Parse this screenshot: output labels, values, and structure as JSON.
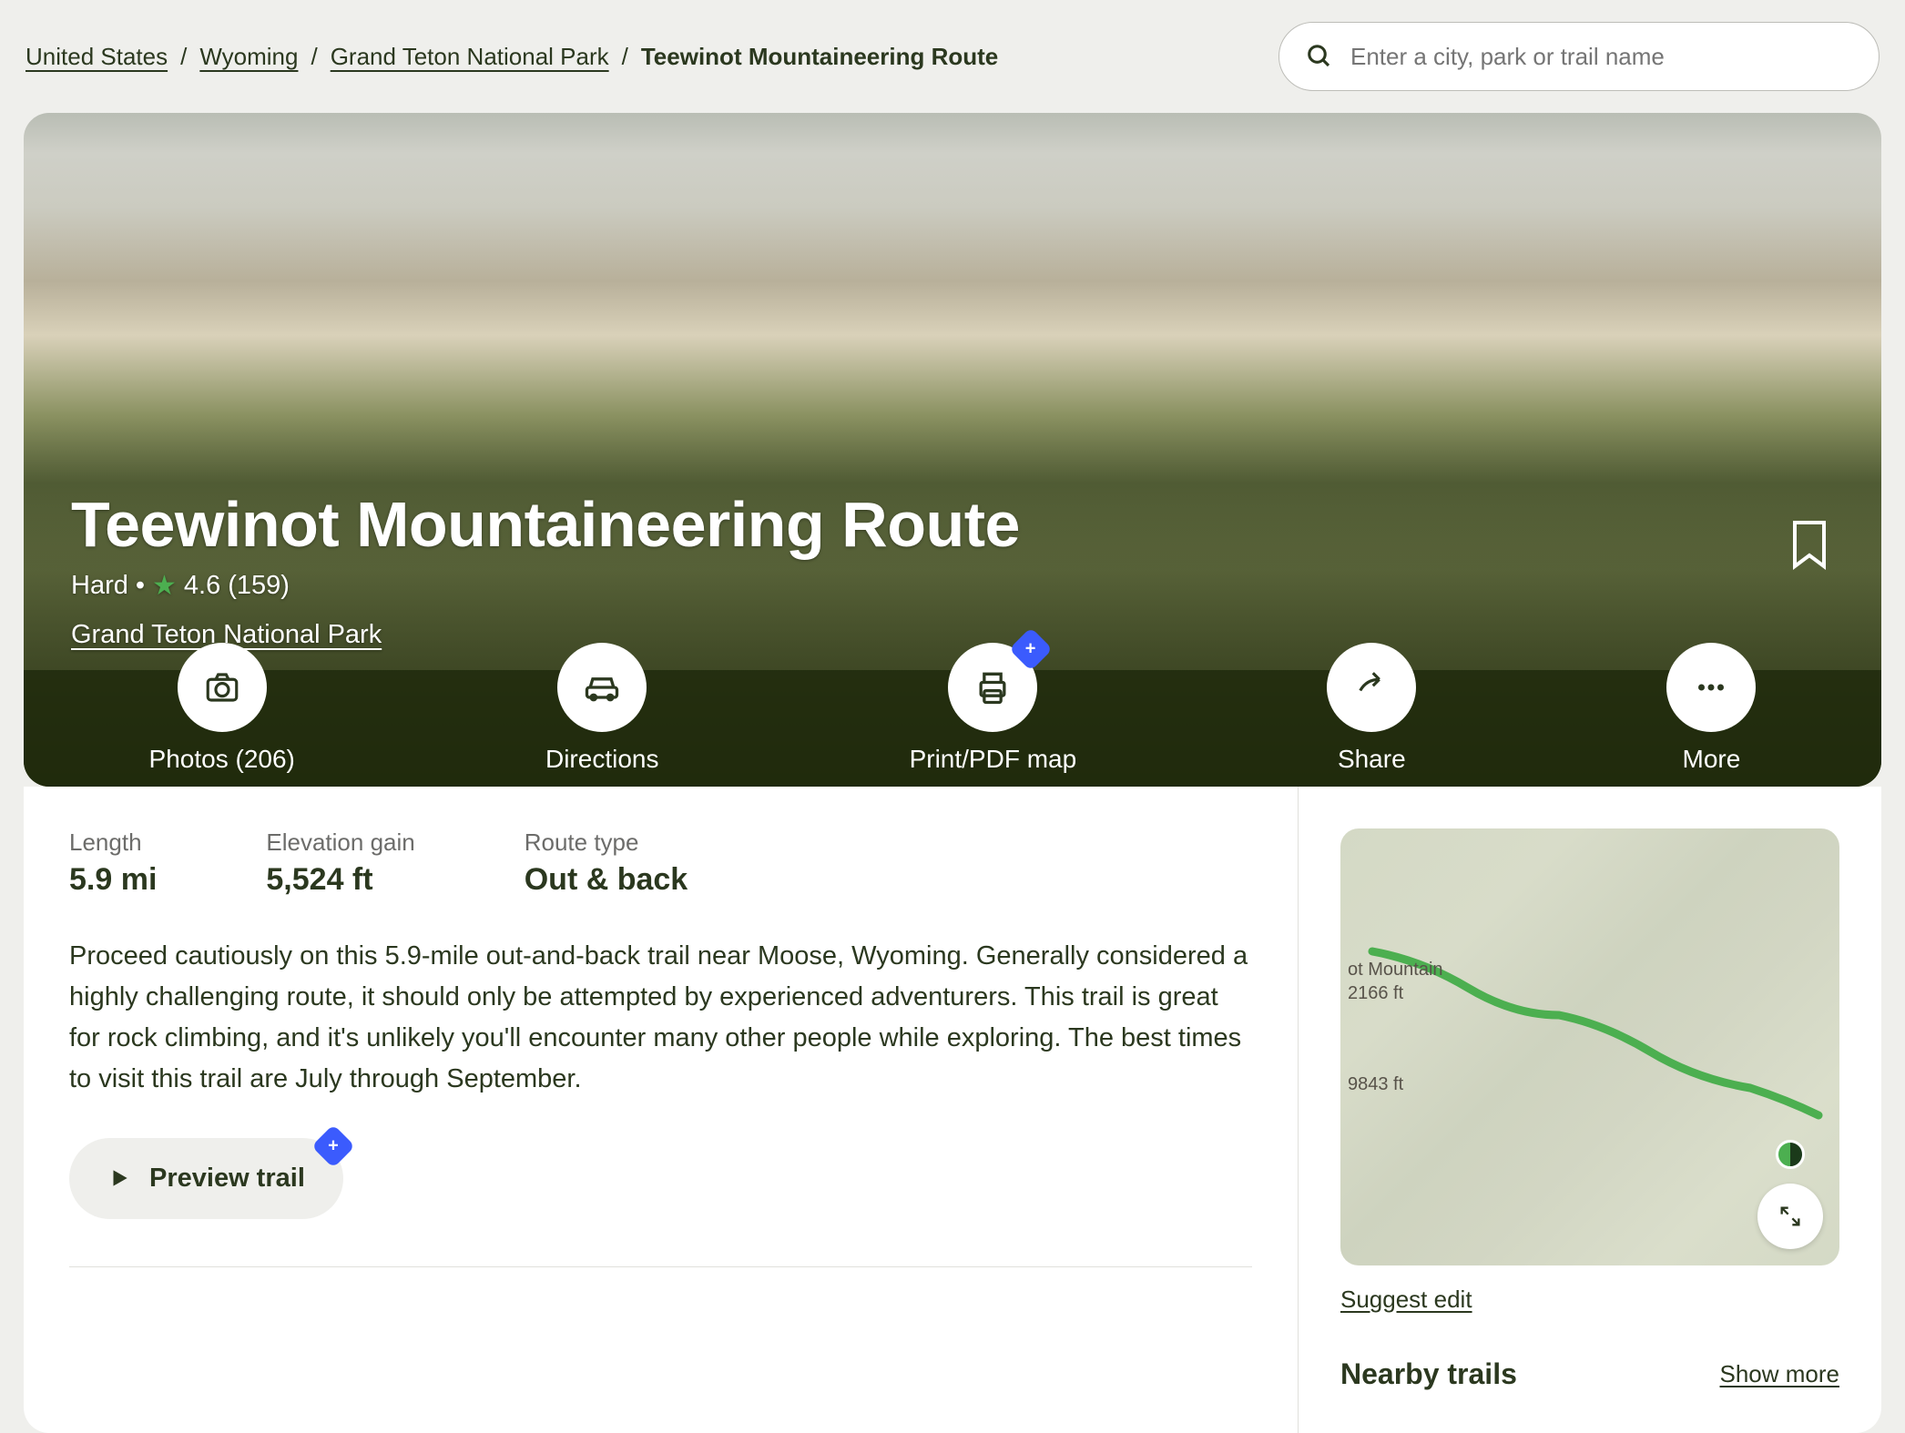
{
  "breadcrumbs": {
    "items": [
      "United States",
      "Wyoming",
      "Grand Teton National Park"
    ],
    "current": "Teewinot Mountaineering Route"
  },
  "search": {
    "placeholder": "Enter a city, park or trail name"
  },
  "hero": {
    "title": "Teewinot Mountaineering Route",
    "difficulty": "Hard",
    "separator": "•",
    "rating": "4.6",
    "review_count": "(159)",
    "park": "Grand Teton National Park"
  },
  "actions": {
    "photos": "Photos (206)",
    "directions": "Directions",
    "print": "Print/PDF map",
    "share": "Share",
    "more": "More"
  },
  "stats": {
    "length_label": "Length",
    "length_value": "5.9 mi",
    "elevation_label": "Elevation gain",
    "elevation_value": "5,524 ft",
    "route_label": "Route type",
    "route_value": "Out & back"
  },
  "description": "Proceed cautiously on this 5.9-mile out-and-back trail near Moose, Wyoming. Generally considered a highly challenging route, it should only be attempted by experienced adventurers. This trail is great for rock climbing, and it's unlikely you'll encounter many other people while exploring. The best times to visit this trail are July through September.",
  "preview_btn": "Preview trail",
  "map": {
    "label1": "ot Mountain",
    "label2": "2166 ft",
    "label3": "9843 ft"
  },
  "suggest_edit": "Suggest edit",
  "nearby_title": "Nearby trails",
  "show_more": "Show more"
}
